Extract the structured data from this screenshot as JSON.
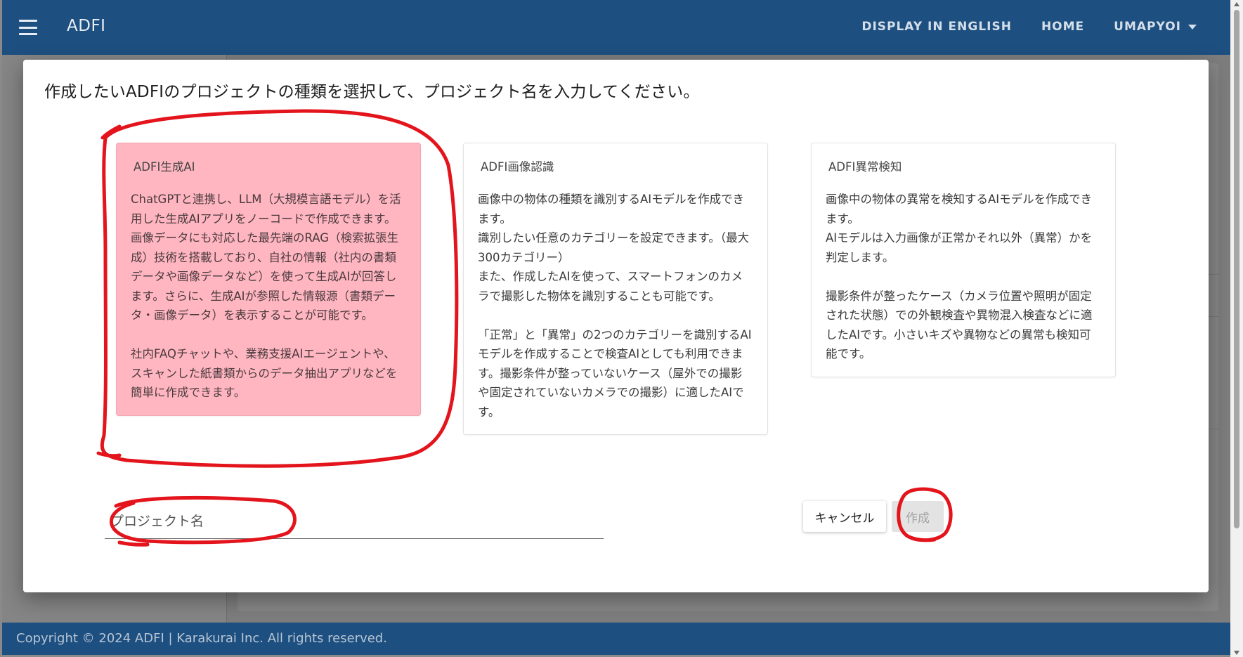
{
  "appbar": {
    "brand": "ADFI",
    "nav": {
      "english": "DISPLAY IN ENGLISH",
      "home": "HOME",
      "user": "UMAPYOI"
    }
  },
  "dialog": {
    "title": "作成したいADFIのプロジェクトの種類を選択して、プロジェクト名を入力してください。",
    "cards": [
      {
        "title": "ADFI生成AI",
        "body": "ChatGPTと連携し、LLM（大規模言語モデル）を活用した生成AIアプリをノーコードで作成できます。\n画像データにも対応した最先端のRAG（検索拡張生成）技術を搭載しており、自社の情報（社内の書類データや画像データなど）を使って生成AIが回答します。さらに、生成AIが参照した情報源（書類データ・画像データ）を表示することが可能です。\n\n社内FAQチャットや、業務支援AIエージェントや、スキャンした紙書類からのデータ抽出アプリなどを簡単に作成できます。",
        "selected": true
      },
      {
        "title": "ADFI画像認識",
        "body": "画像中の物体の種類を識別するAIモデルを作成できます。\n識別したい任意のカテゴリーを設定できます。（最大300カテゴリー）\nまた、作成したAIを使って、スマートフォンのカメラで撮影した物体を識別することも可能です。\n\n「正常」と「異常」の2つのカテゴリーを識別するAIモデルを作成することで検査AIとしても利用できます。撮影条件が整っていないケース（屋外での撮影や固定されていないカメラでの撮影）に適したAIです。",
        "selected": false
      },
      {
        "title": "ADFI異常検知",
        "body": "画像中の物体の異常を検知するAIモデルを作成できます。\nAIモデルは入力画像が正常かそれ以外（異常）かを判定します。\n\n撮影条件が整ったケース（カメラ位置や照明が固定された状態）での外観検査や異物混入検査などに適したAIです。小さいキズや異物などの異常も検知可能です。",
        "selected": false
      }
    ],
    "project_name_placeholder": "プロジェクト名",
    "project_name_value": "",
    "cancel_label": "キャンセル",
    "create_label": "作成"
  },
  "footer": {
    "copyright": "Copyright © 2024 ADFI | Karakurai Inc. All rights reserved."
  },
  "colors": {
    "appbar": "#1d4f80",
    "selected_card": "#ffb6c1",
    "annotation": "#e3141c"
  },
  "icons": {
    "menu": "hamburger-menu-icon",
    "dropdown": "caret-down-icon"
  }
}
